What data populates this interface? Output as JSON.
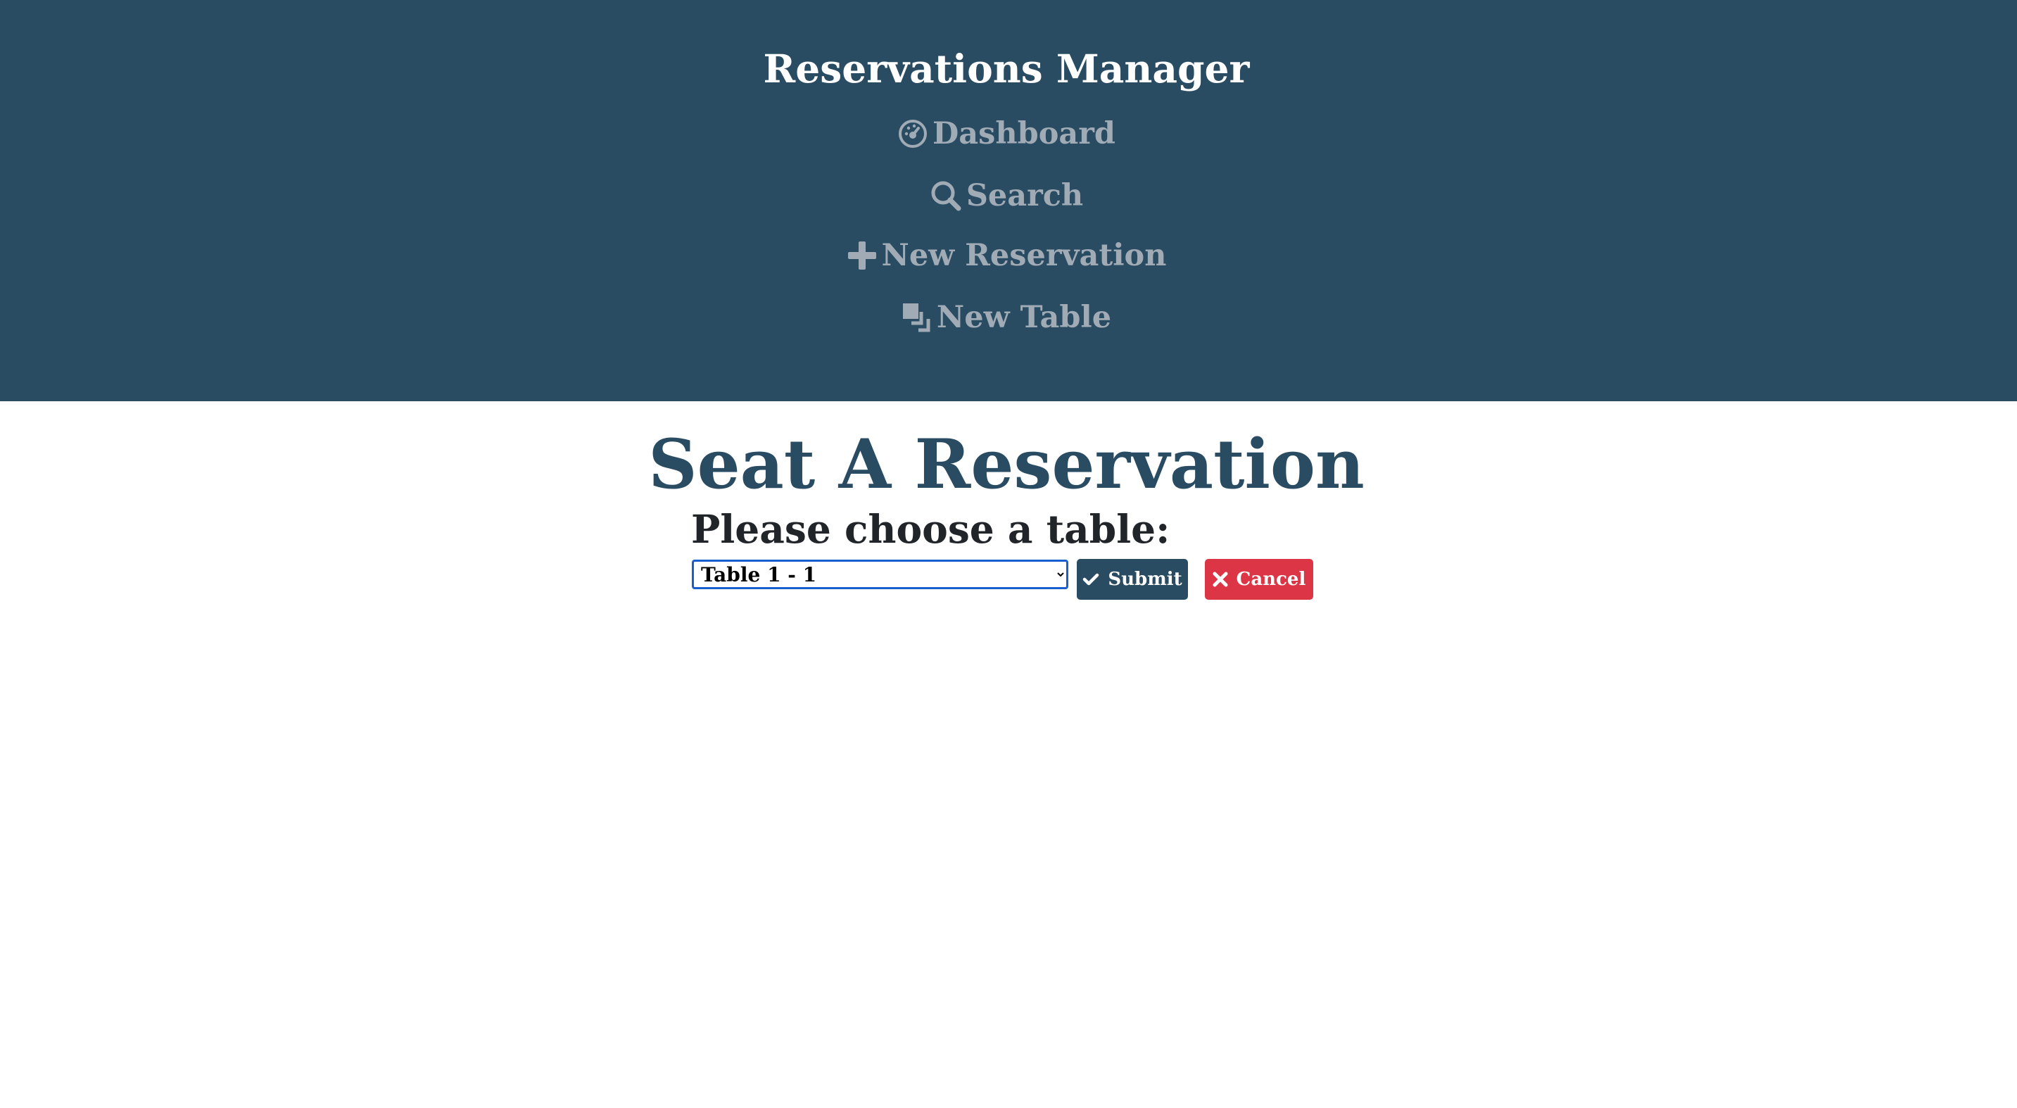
{
  "header": {
    "title": "Reservations Manager",
    "nav": [
      {
        "label": "Dashboard",
        "icon": "dashboard-icon"
      },
      {
        "label": "Search",
        "icon": "search-icon"
      },
      {
        "label": "New Reservation",
        "icon": "plus-icon"
      },
      {
        "label": "New Table",
        "icon": "table-icon"
      }
    ]
  },
  "main": {
    "title": "Seat A Reservation",
    "label": "Please choose a table:",
    "select": {
      "selected": "Table 1 - 1"
    },
    "submit_label": "Submit",
    "cancel_label": "Cancel"
  },
  "colors": {
    "header_bg": "#294c63",
    "nav_text": "#a0abb5",
    "submit_bg": "#294c63",
    "cancel_bg": "#dc3545"
  }
}
